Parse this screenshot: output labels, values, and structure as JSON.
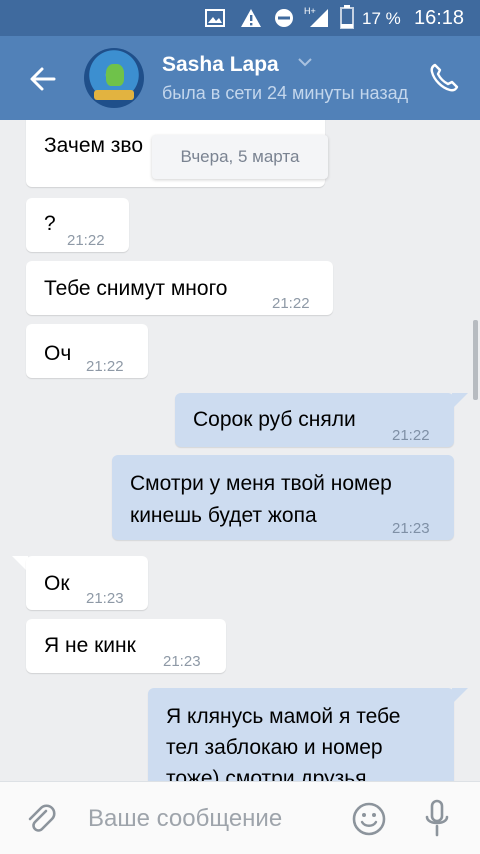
{
  "status_bar": {
    "battery_percent": "17 %",
    "time": "16:18",
    "icons": [
      "image-icon",
      "warning-icon",
      "do-not-disturb-icon",
      "network-hplus-icon",
      "battery-icon"
    ]
  },
  "header": {
    "name": "Sasha Lapa",
    "status": "была в сети 24 минуты назад",
    "back_icon": "arrow-left-icon",
    "call_icon": "phone-icon"
  },
  "chat": {
    "date_divider": "Вчера, 5 марта",
    "messages": [
      {
        "dir": "in",
        "lines": [
          "Зачем зво"
        ],
        "time": ""
      },
      {
        "dir": "in",
        "lines": [
          "?"
        ],
        "time": "21:22"
      },
      {
        "dir": "in",
        "lines": [
          "Тебе снимут много"
        ],
        "time": "21:22"
      },
      {
        "dir": "in",
        "lines": [
          "Оч"
        ],
        "time": "21:22"
      },
      {
        "dir": "out",
        "lines": [
          "Сорок руб сняли"
        ],
        "time": "21:22"
      },
      {
        "dir": "out",
        "lines": [
          "Смотри у меня твой номер",
          "кинешь будет жопа"
        ],
        "time": "21:23"
      },
      {
        "dir": "in",
        "lines": [
          "Ок"
        ],
        "time": "21:23"
      },
      {
        "dir": "in",
        "lines": [
          "Я не кинк"
        ],
        "time": "21:23"
      },
      {
        "dir": "out",
        "lines": [
          "Я клянусь мамой я тебе",
          "тел заблокаю и номер",
          "тоже) смотри друзья"
        ],
        "time": ""
      }
    ]
  },
  "composer": {
    "placeholder": "Ваше сообщение",
    "attach_icon": "paperclip-icon",
    "emoji_icon": "smile-icon",
    "mic_icon": "microphone-icon"
  },
  "colors": {
    "status_bar": "#3f6a9e",
    "header": "#5181b8",
    "background": "#edeef0",
    "incoming_bubble": "#ffffff",
    "outgoing_bubble": "#cddcf0"
  }
}
